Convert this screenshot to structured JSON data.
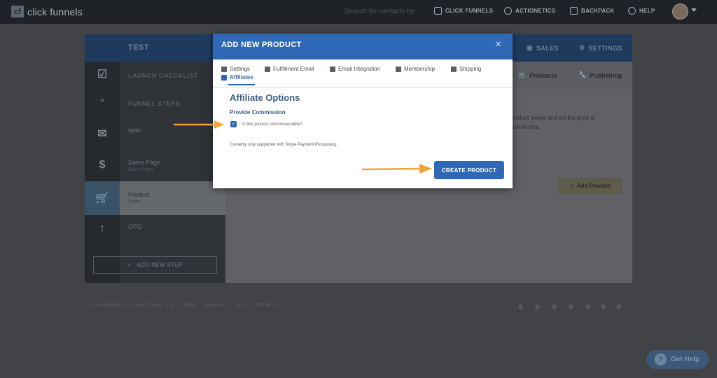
{
  "topnav": {
    "logo_text": "click funnels",
    "search_placeholder": "Search for contacts by e",
    "items": [
      {
        "label": "CLICK FUNNELS",
        "icon": "funnel-icon"
      },
      {
        "label": "ACTIONETICS",
        "icon": "actionetics-icon"
      },
      {
        "label": "BACKPACK",
        "icon": "backpack-icon"
      },
      {
        "label": "HELP",
        "icon": "lifebuoy-icon"
      }
    ]
  },
  "funnel": {
    "title": "TEST",
    "header_tabs": [
      {
        "label": "SALES",
        "icon": "sales-icon"
      },
      {
        "label": "SETTINGS",
        "icon": "gear-icon"
      }
    ],
    "sidebar": {
      "launch_checklist": "LAUNCH CHECKLIST",
      "funnel_steps": "FUNNEL STEPS",
      "steps": [
        {
          "title": "optin",
          "subtitle": ""
        },
        {
          "title": "Sales Page",
          "subtitle": "Sales Page"
        },
        {
          "title": "Product",
          "subtitle": "Order"
        },
        {
          "title": "OTO",
          "subtitle": ""
        }
      ],
      "add_step": "ADD NEW STEP"
    },
    "content_tabs": [
      {
        "label": "Products",
        "icon": "cart-icon"
      },
      {
        "label": "Publishing",
        "icon": "wrench-icon"
      }
    ],
    "content_lines": [
      "roduct' below and set the price of",
      "unnel step."
    ],
    "add_product": "Add Product"
  },
  "footer": {
    "links": [
      "CLICKFUNNELS - © 2018 ETISON LLC",
      "TERMS",
      "PRIVACY",
      "DOCS",
      "GET HELP"
    ]
  },
  "gethelp": {
    "label": "Get Help"
  },
  "modal": {
    "title": "ADD NEW PRODUCT",
    "close": "×",
    "tabs": [
      {
        "label": "Settings",
        "icon": "gears-icon"
      },
      {
        "label": "Fulfillment Email",
        "icon": "envelope-icon"
      },
      {
        "label": "Email Integration",
        "icon": "pencil-icon"
      },
      {
        "label": "Membership",
        "icon": "users-icon"
      },
      {
        "label": "Shipping",
        "icon": "user-box-icon"
      },
      {
        "label": "Affiliates",
        "icon": "cart-icon"
      }
    ],
    "active_tab": "Affiliates",
    "section_title": "Affiliate Options",
    "field_label": "Provide Commission",
    "checkbox_checked": true,
    "checkbox_label": "Is this product commissionable?",
    "note": "Currently only supported with Stripe Payment Processing.",
    "create_button": "CREATE PRODUCT"
  },
  "colors": {
    "modal_header": "#2f69b5",
    "primary_button": "#2f69b5",
    "arrow": "#f2a33a",
    "topbar": "#1f2327"
  }
}
